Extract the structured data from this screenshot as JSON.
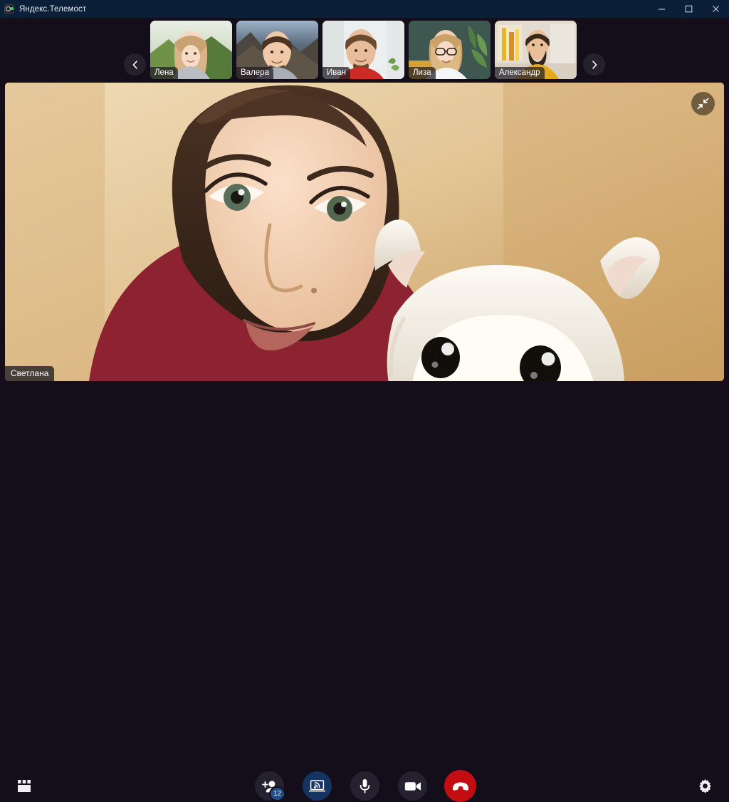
{
  "window": {
    "title": "Яндекс.Телемост",
    "app_icon": "camera-status-icon",
    "minimize_label": "–",
    "maximize_label": "□",
    "close_label": "✕"
  },
  "colors": {
    "titlebar": "#0b2038",
    "background": "#130e1a",
    "accent_blue": "#143561",
    "badge_blue": "#1f4f85",
    "end_call_red": "#c20e13",
    "button_dark": "#262130",
    "text": "#ffffff"
  },
  "thumbnail_strip": {
    "prev_label": "‹",
    "next_label": "›",
    "participants": [
      {
        "name": "Лена",
        "bg": "mountain-green"
      },
      {
        "name": "Валера",
        "bg": "mountain-rocky"
      },
      {
        "name": "Иван",
        "bg": "room-white"
      },
      {
        "name": "Лиза",
        "bg": "room-plant"
      },
      {
        "name": "Александр",
        "bg": "room-art"
      }
    ]
  },
  "stage": {
    "speaker_name": "Светлана",
    "collapse_icon": "collapse-arrows-icon"
  },
  "toolbar": {
    "layout_label": "Вид",
    "add_participant": {
      "icon": "add-person-icon",
      "badge": "12",
      "label": "Участники"
    },
    "screen_share": {
      "icon": "screen-share-icon",
      "label": "Демонстрация экрана",
      "active": true
    },
    "microphone": {
      "icon": "microphone-icon",
      "label": "Микрофон",
      "muted": false
    },
    "camera": {
      "icon": "camera-icon",
      "label": "Камера",
      "off": false
    },
    "end_call": {
      "icon": "end-call-icon",
      "label": "Завершить звонок"
    },
    "settings": {
      "icon": "gear-icon",
      "label": "Настройки"
    }
  }
}
